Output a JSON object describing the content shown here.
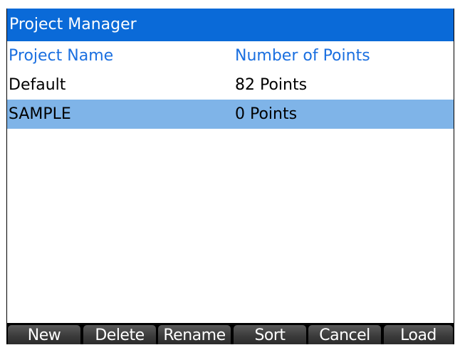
{
  "window": {
    "title": "Project Manager"
  },
  "table": {
    "headers": {
      "name": "Project Name",
      "points": "Number of Points"
    },
    "rows": [
      {
        "name": "Default",
        "points": "82 Points",
        "selected": false
      },
      {
        "name": "SAMPLE",
        "points": "0 Points",
        "selected": true
      }
    ]
  },
  "softkeys": {
    "new": "New",
    "delete": "Delete",
    "rename": "Rename",
    "sort": "Sort",
    "cancel": "Cancel",
    "load": "Load"
  },
  "colors": {
    "title_bar": "#0a6ad8",
    "header_text": "#1a6fe0",
    "selection": "#7fb4e8"
  }
}
